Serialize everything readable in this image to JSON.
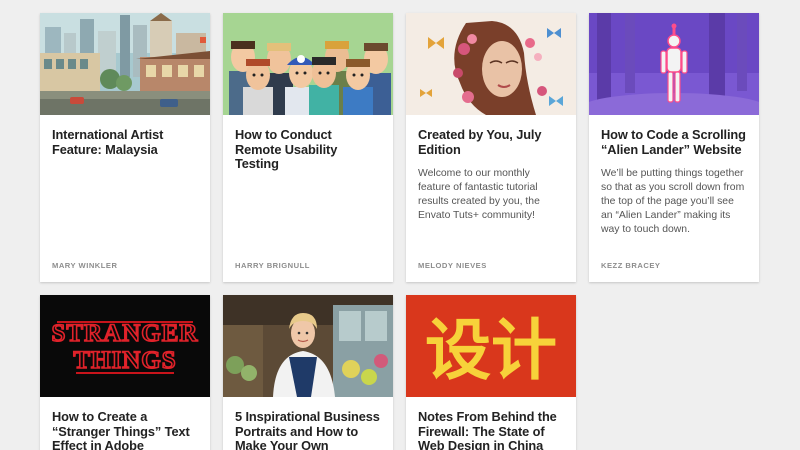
{
  "cards": [
    {
      "title": "International Artist Feature: Malaysia",
      "excerpt": "",
      "author": "MARY WINKLER",
      "thumbnail": "malaysia-street-illustration"
    },
    {
      "title": "How to Conduct Remote Usability Testing",
      "excerpt": "",
      "author": "HARRY BRIGNULL",
      "thumbnail": "cartoon-people-group"
    },
    {
      "title": "Created by You, July Edition",
      "excerpt": "Welcome to our monthly feature of fantastic tutorial results created by you, the Envato Tuts+ community!",
      "author": "MELODY NIEVES",
      "thumbnail": "floral-portrait-with-butterflies"
    },
    {
      "title": "How to Code a Scrolling “Alien Lander” Website",
      "excerpt": "We’ll be putting things together so that as you scroll down from the top of the page you’ll see an “Alien Lander” making its way to touch down.",
      "author": "KEZZ BRACEY",
      "thumbnail": "alien-in-purple-forest"
    },
    {
      "title": "How to Create a “Stranger Things” Text Effect in Adobe",
      "excerpt": "",
      "author": "",
      "thumbnail": "stranger-things-neon-logo",
      "thumb_text_1": "STRANGER",
      "thumb_text_2": "THINGS"
    },
    {
      "title": "5 Inspirational Business Portraits and How to Make Your Own",
      "excerpt": "",
      "author": "",
      "thumbnail": "florist-shop-portrait"
    },
    {
      "title": "Notes From Behind the Firewall: The State of Web Design in China",
      "excerpt": "",
      "author": "",
      "thumbnail": "chinese-design-characters",
      "thumb_text_1": "设计"
    }
  ],
  "colors": {
    "page_bg": "#efefef",
    "card_bg": "#ffffff",
    "title": "#222222",
    "excerpt": "#555555",
    "author": "#8d8d8d",
    "china_red": "#d9371c",
    "china_yellow": "#f7d23a",
    "stranger_red": "#c8141b"
  }
}
